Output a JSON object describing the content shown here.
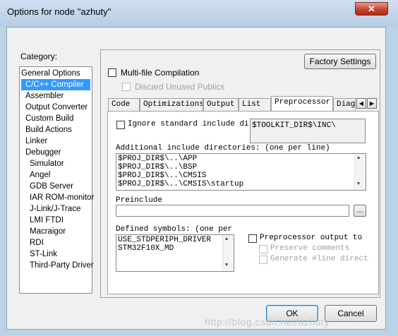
{
  "window": {
    "title": "Options for node \"azhuty\"",
    "close_glyph": "✕"
  },
  "category": {
    "label": "Category:",
    "items": [
      "General Options",
      "C/C++ Compiler",
      "Assembler",
      "Output Converter",
      "Custom Build",
      "Build Actions",
      "Linker",
      "Debugger",
      "Simulator",
      "Angel",
      "GDB Server",
      "IAR ROM-monitor",
      "J-Link/J-Trace",
      "LMI FTDI",
      "Macraigor",
      "RDI",
      "ST-Link",
      "Third-Party Driver"
    ],
    "selected": "C/C++ Compiler"
  },
  "panel": {
    "factory_settings": "Factory Settings",
    "multifile": "Multi-file Compilation",
    "discard": "Discard Unused Publics"
  },
  "tabs": [
    "Code",
    "Optimizations",
    "Output",
    "List",
    "Preprocessor",
    "Diagn"
  ],
  "preprocessor": {
    "ignore_std": "Ignore standard include dire",
    "toolkit_path": "$TOOLKIT_DIR$\\INC\\",
    "additional_label": "Additional include directories: (one per line)",
    "include_dirs": [
      "$PROJ_DIR$\\..\\APP",
      "$PROJ_DIR$\\..\\BSP",
      "$PROJ_DIR$\\..\\CMSIS",
      "$PROJ_DIR$\\..\\CMSIS\\startup"
    ],
    "preinclude_label": "Preinclude",
    "preinclude_value": "",
    "browse": "...",
    "defined_label": "Defined symbols: (one per",
    "defined_symbols": [
      "USE_STDPERIPH_DRIVER",
      "STM32F10X_MD"
    ],
    "pp_output": "Preprocessor output to",
    "preserve": "Preserve comments",
    "generate": "Generate #line directive"
  },
  "footer": {
    "ok": "OK",
    "cancel": "Cancel"
  },
  "watermark": "http://blog.csdn.net/azhuty"
}
